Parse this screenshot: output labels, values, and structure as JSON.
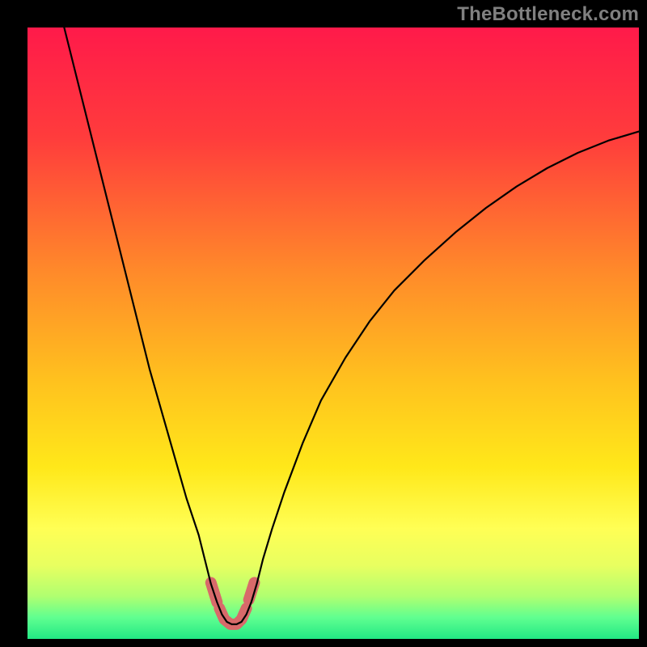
{
  "watermark": "TheBottleneck.com",
  "chart_data": {
    "type": "line",
    "title": "",
    "xlabel": "",
    "ylabel": "",
    "xlim": [
      0,
      100
    ],
    "ylim": [
      0,
      100
    ],
    "grid": false,
    "legend": false,
    "background_gradient_stops": [
      {
        "offset": 0.0,
        "color": "#ff1a4a"
      },
      {
        "offset": 0.18,
        "color": "#ff3c3c"
      },
      {
        "offset": 0.4,
        "color": "#ff8a2a"
      },
      {
        "offset": 0.58,
        "color": "#ffc21e"
      },
      {
        "offset": 0.72,
        "color": "#ffe81a"
      },
      {
        "offset": 0.82,
        "color": "#ffff55"
      },
      {
        "offset": 0.88,
        "color": "#e8ff60"
      },
      {
        "offset": 0.93,
        "color": "#b0ff70"
      },
      {
        "offset": 0.965,
        "color": "#60ff90"
      },
      {
        "offset": 1.0,
        "color": "#22e884"
      }
    ],
    "series": [
      {
        "name": "bottleneck-curve",
        "stroke": "#000000",
        "stroke_width": 2.2,
        "points_xy": [
          [
            6,
            100
          ],
          [
            8,
            92
          ],
          [
            10,
            84
          ],
          [
            12,
            76
          ],
          [
            14,
            68
          ],
          [
            16,
            60
          ],
          [
            18,
            52
          ],
          [
            20,
            44
          ],
          [
            22,
            37
          ],
          [
            24,
            30
          ],
          [
            26,
            23
          ],
          [
            28,
            17
          ],
          [
            29,
            13
          ],
          [
            30,
            9
          ],
          [
            31,
            6
          ],
          [
            31.8,
            4
          ],
          [
            32.6,
            2.8
          ],
          [
            33.4,
            2.4
          ],
          [
            34.2,
            2.4
          ],
          [
            35,
            2.8
          ],
          [
            35.8,
            4
          ],
          [
            36.6,
            6
          ],
          [
            37.5,
            9
          ],
          [
            38.5,
            13
          ],
          [
            40,
            18
          ],
          [
            42,
            24
          ],
          [
            45,
            32
          ],
          [
            48,
            39
          ],
          [
            52,
            46
          ],
          [
            56,
            52
          ],
          [
            60,
            57
          ],
          [
            65,
            62
          ],
          [
            70,
            66.5
          ],
          [
            75,
            70.5
          ],
          [
            80,
            74
          ],
          [
            85,
            77
          ],
          [
            90,
            79.5
          ],
          [
            95,
            81.5
          ],
          [
            100,
            83
          ]
        ]
      }
    ],
    "highlight_segments": [
      {
        "name": "branch-left-start",
        "stroke": "#d86a6a",
        "stroke_width": 14,
        "points_xy": [
          [
            30,
            9.2
          ],
          [
            31,
            6.0
          ]
        ]
      },
      {
        "name": "trough",
        "stroke": "#d86a6a",
        "stroke_width": 14,
        "points_xy": [
          [
            31.4,
            5.0
          ],
          [
            32.2,
            3.2
          ],
          [
            33.2,
            2.4
          ],
          [
            34.2,
            2.4
          ],
          [
            35.0,
            3.2
          ],
          [
            35.8,
            5.0
          ]
        ]
      },
      {
        "name": "branch-right-start",
        "stroke": "#d86a6a",
        "stroke_width": 14,
        "points_xy": [
          [
            36.2,
            6.4
          ],
          [
            37.1,
            9.2
          ]
        ]
      }
    ]
  }
}
